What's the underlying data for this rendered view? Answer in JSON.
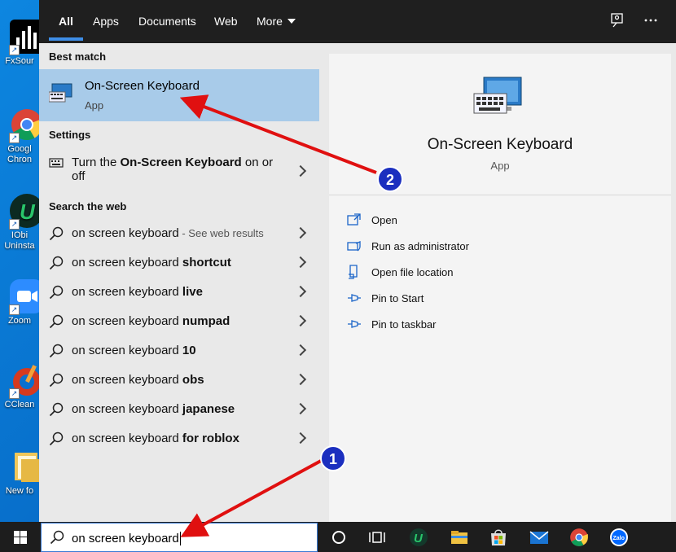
{
  "desktop": {
    "icons": [
      {
        "name": "FxSound",
        "label": "FxSour"
      },
      {
        "name": "Google Chrome",
        "label": "Googl\nChron"
      },
      {
        "name": "IObit Uninstaller",
        "label": "IObi\nUninsta"
      },
      {
        "name": "Zoom",
        "label": "Zoom"
      },
      {
        "name": "CCleaner",
        "label": "CClean"
      },
      {
        "name": "New folder",
        "label": "New fo"
      }
    ]
  },
  "search": {
    "tabs": [
      "All",
      "Apps",
      "Documents",
      "Web",
      "More"
    ],
    "active_tab": "All",
    "best_match_header": "Best match",
    "best_match": {
      "title": "On-Screen Keyboard",
      "type": "App"
    },
    "settings_header": "Settings",
    "settings_item": {
      "pre": "Turn the ",
      "bold": "On-Screen Keyboard",
      "post": " on or",
      "line2": "off"
    },
    "web_header": "Search the web",
    "web_results": [
      {
        "base": "on screen keyboard",
        "bold": "",
        "hint": " - See web results"
      },
      {
        "base": "on screen keyboard ",
        "bold": "shortcut",
        "hint": ""
      },
      {
        "base": "on screen keyboard ",
        "bold": "live",
        "hint": ""
      },
      {
        "base": "on screen keyboard ",
        "bold": "numpad",
        "hint": ""
      },
      {
        "base": "on screen keyboard ",
        "bold": "10",
        "hint": ""
      },
      {
        "base": "on screen keyboard ",
        "bold": "obs",
        "hint": ""
      },
      {
        "base": "on screen keyboard ",
        "bold": "japanese",
        "hint": ""
      },
      {
        "base": "on screen keyboard ",
        "bold": "for roblox",
        "hint": ""
      }
    ],
    "query": "on screen keyboard"
  },
  "preview": {
    "title": "On-Screen Keyboard",
    "subtitle": "App",
    "actions": [
      {
        "label": "Open",
        "icon": "open-icon"
      },
      {
        "label": "Run as administrator",
        "icon": "run-as-admin-icon"
      },
      {
        "label": "Open file location",
        "icon": "file-location-icon"
      },
      {
        "label": "Pin to Start",
        "icon": "pin-icon"
      },
      {
        "label": "Pin to taskbar",
        "icon": "pin-icon"
      }
    ]
  },
  "annotations": [
    {
      "number": "1",
      "target": "search box"
    },
    {
      "number": "2",
      "target": "best match"
    }
  ],
  "colors": {
    "accent": "#3e8ee8",
    "best_match_bg": "#a8cbe9",
    "arrow": "#e01010",
    "badge": "#1b2fbf"
  }
}
